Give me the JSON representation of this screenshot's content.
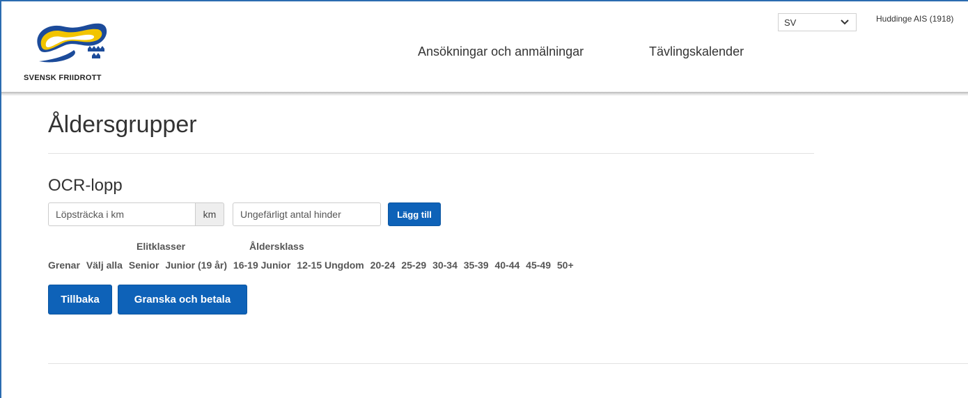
{
  "brand": {
    "name": "SVENSK FRIIDROTT",
    "colors": {
      "blue": "#1c4b9a",
      "yellow": "#f2c400",
      "accent": "#0e62b8"
    }
  },
  "nav": {
    "items": [
      {
        "label": "Ansökningar och anmälningar"
      },
      {
        "label": "Tävlingskalender"
      }
    ]
  },
  "language": {
    "selected": "SV"
  },
  "user": {
    "name": "Huddinge AIS (1918)"
  },
  "page": {
    "title": "Åldersgrupper"
  },
  "section": {
    "title": "OCR-lopp",
    "distance_placeholder": "Löpsträcka i km",
    "distance_unit": "km",
    "obstacles_placeholder": "Ungefärligt antal hinder",
    "add_label": "Lägg till"
  },
  "table": {
    "group_headers": {
      "elite": "Elitklasser",
      "age": "Åldersklass"
    },
    "columns": [
      "Grenar",
      "Välj alla",
      "Senior",
      "Junior (19 år)",
      "16-19 Junior",
      "12-15 Ungdom",
      "20-24",
      "25-29",
      "30-34",
      "35-39",
      "40-44",
      "45-49",
      "50+"
    ]
  },
  "actions": {
    "back_label": "Tillbaka",
    "review_label": "Granska och betala"
  }
}
